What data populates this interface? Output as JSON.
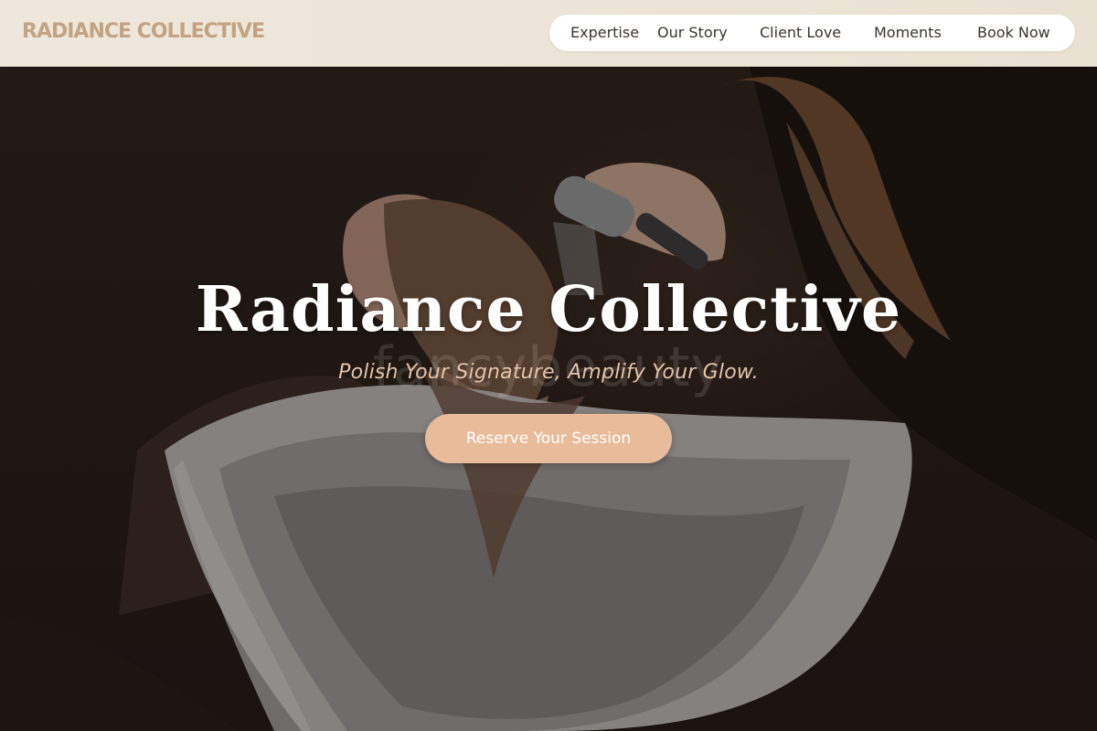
{
  "brand": {
    "name": "RADIANCE COLLECTIVE"
  },
  "nav": {
    "items": [
      {
        "label": "Expertise"
      },
      {
        "label": "Our Story"
      },
      {
        "label": "Client Love"
      },
      {
        "label": "Moments"
      },
      {
        "label": "Book Now"
      }
    ]
  },
  "hero": {
    "title": "Radiance Collective",
    "watermark": "fancybeauty",
    "tagline": "Polish Your Signature, Amplify Your Glow.",
    "cta_label": "Reserve Your Session"
  },
  "colors": {
    "brand": "#c3a381",
    "header_bg": "#eee8dc",
    "cta_bg": "#e8bb9a",
    "tagline": "#e3c3a8"
  }
}
